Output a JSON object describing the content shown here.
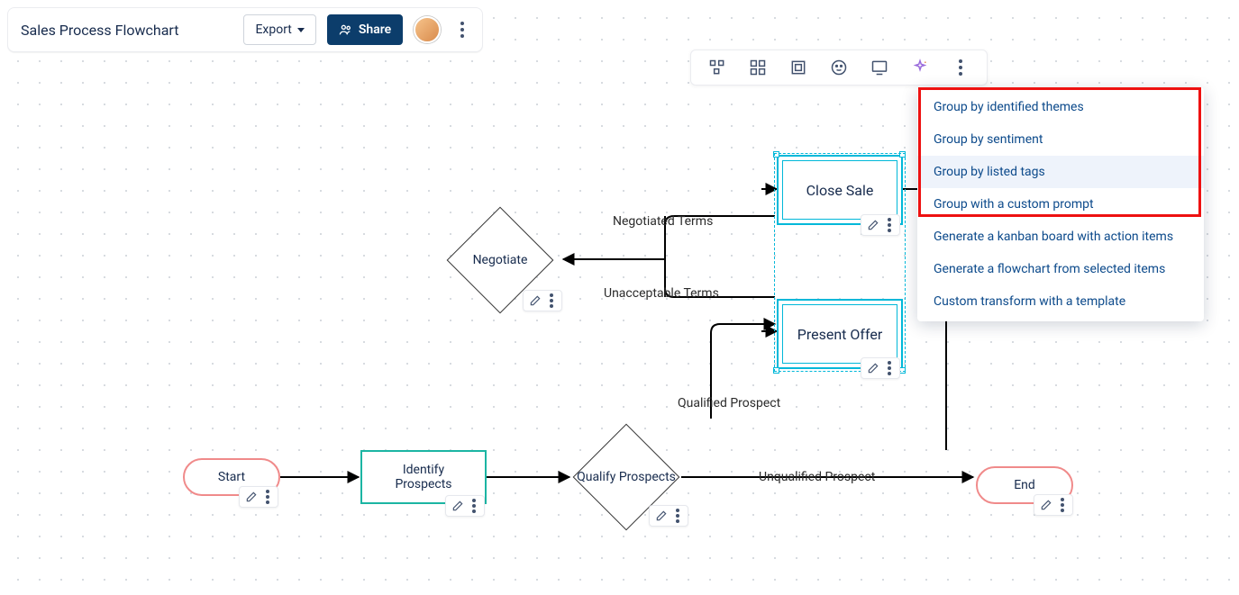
{
  "header": {
    "title": "Sales Process Flowchart",
    "export_label": "Export",
    "share_label": "Share"
  },
  "dropdown": {
    "items": [
      "Group by identified themes",
      "Group by sentiment",
      "Group by listed tags",
      "Group with a custom prompt",
      "Generate a kanban board with action items",
      "Generate a flowchart from selected items",
      "Custom transform with a template"
    ],
    "highlighted_index": 2
  },
  "nodes": {
    "start": "Start",
    "identify": "Identify Prospects",
    "qualify": "Qualify Prospects",
    "negotiate": "Negotiate",
    "close": "Close Sale",
    "present": "Present Offer",
    "end": "End"
  },
  "edges": {
    "negotiated": "Negotiated Terms",
    "unacceptable": "Unacceptable Terms",
    "qualified": "Qualified Prospect",
    "unqualified": "Unqualified Prospect"
  }
}
